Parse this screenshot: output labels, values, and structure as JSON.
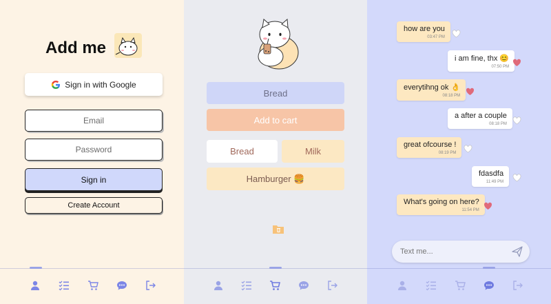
{
  "auth": {
    "title": "Add me",
    "google_label": "Sign in with Google",
    "email_placeholder": "Email",
    "password_placeholder": "Password",
    "signin_label": "Sign in",
    "create_label": "Create Account"
  },
  "shop": {
    "bread_top": "Bread",
    "add_to_cart": "Add to cart",
    "chips": [
      "Bread",
      "Milk",
      "Hamburger 🍔"
    ]
  },
  "chat": {
    "messages": [
      {
        "text": "how are you",
        "time": "03:47 PM",
        "from": "them",
        "liked": false
      },
      {
        "text": "i am fine, thx 😊",
        "time": "07:50 PM",
        "from": "me",
        "liked": true
      },
      {
        "text": "everytihng ok 👌",
        "time": "08:18 PM",
        "from": "them",
        "liked": true
      },
      {
        "text": "a after a couple",
        "time": "08:18 PM",
        "from": "me",
        "liked": false
      },
      {
        "text": "great ofcourse !",
        "time": "08:19 PM",
        "from": "them",
        "liked": false
      },
      {
        "text": "fdasdfa",
        "time": "11:49 PM",
        "from": "me",
        "liked": false
      },
      {
        "text": "What's going on here?",
        "time": "11:54 PM",
        "from": "them",
        "liked": true
      }
    ],
    "input_placeholder": "Text me..."
  },
  "nav": {
    "items": [
      "user-icon",
      "list-icon",
      "cart-icon",
      "chat-icon",
      "logout-icon"
    ]
  },
  "colors": {
    "panel_auth": "#fdf3e5",
    "panel_shop": "#eaebf0",
    "panel_chat": "#d3d9fb",
    "accent": "#7c86e6",
    "heart_liked": "#e06a7a"
  }
}
